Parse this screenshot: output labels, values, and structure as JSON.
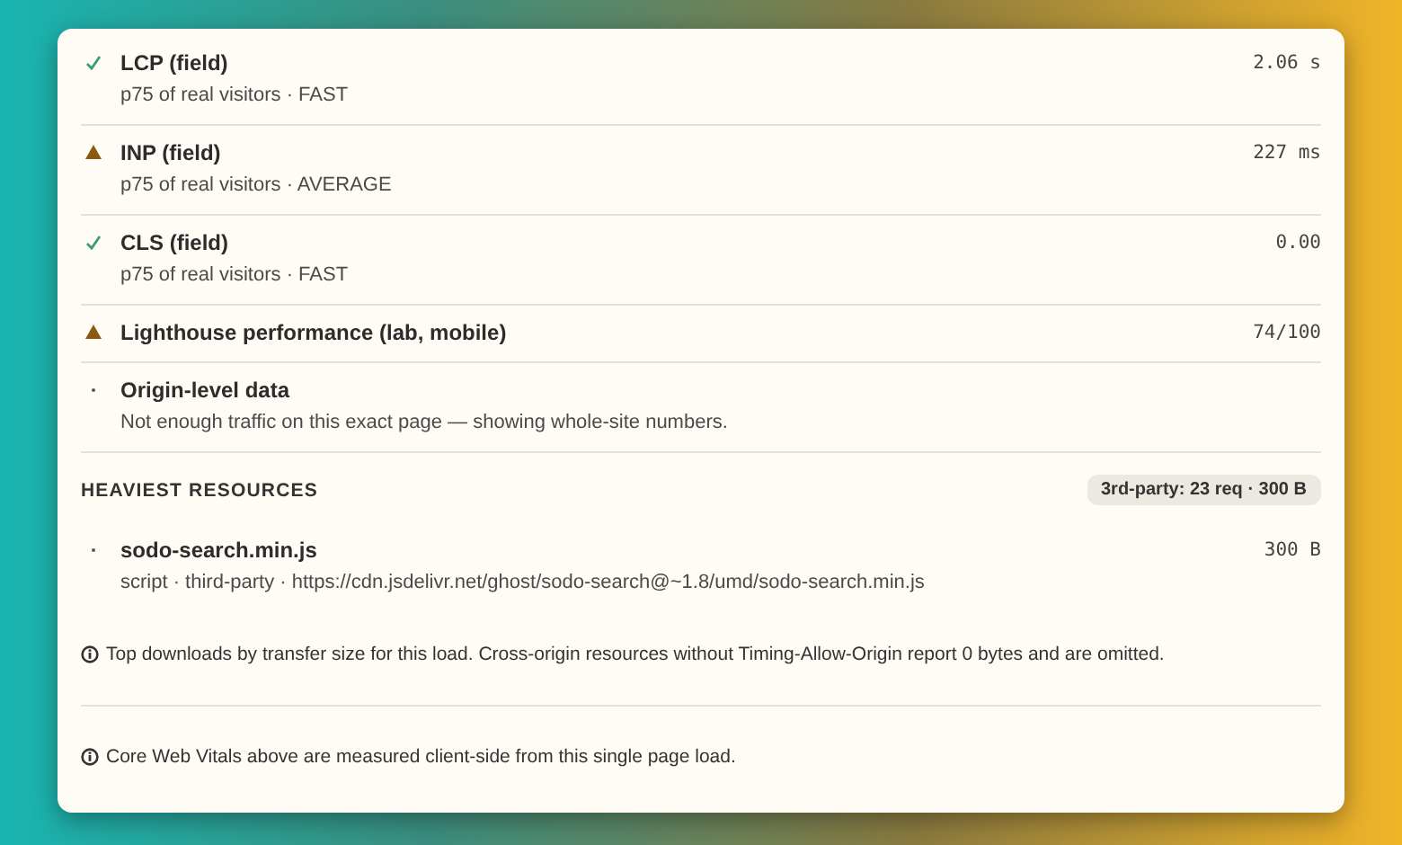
{
  "metrics": [
    {
      "kind": "pass",
      "title": "LCP (field)",
      "subtitle": "p75 of real visitors · FAST",
      "value": "2.06 s"
    },
    {
      "kind": "warn",
      "title": "INP (field)",
      "subtitle": "p75 of real visitors · AVERAGE",
      "value": "227 ms"
    },
    {
      "kind": "pass",
      "title": "CLS (field)",
      "subtitle": "p75 of real visitors · FAST",
      "value": "0.00"
    },
    {
      "kind": "warn",
      "title": "Lighthouse performance (lab, mobile)",
      "value": "74/100"
    },
    {
      "kind": "info",
      "title": "Origin-level data",
      "subtitle": "Not enough traffic on this exact page — showing whole-site numbers."
    }
  ],
  "resources": {
    "heading": "HEAVIEST RESOURCES",
    "badge": "3rd-party: 23 req · 300 B",
    "items": [
      {
        "kind": "info",
        "title": "sodo-search.min.js",
        "subtitle": "script · third-party · https://cdn.jsdelivr.net/ghost/sodo-search@~1.8/umd/sodo-search.min.js",
        "value": "300 B"
      }
    ],
    "note": "Top downloads by transfer size for this load. Cross-origin resources without Timing-Allow-Origin report 0 bytes and are omitted."
  },
  "footer_note": "Core Web Vitals above are measured client-side from this single page load."
}
